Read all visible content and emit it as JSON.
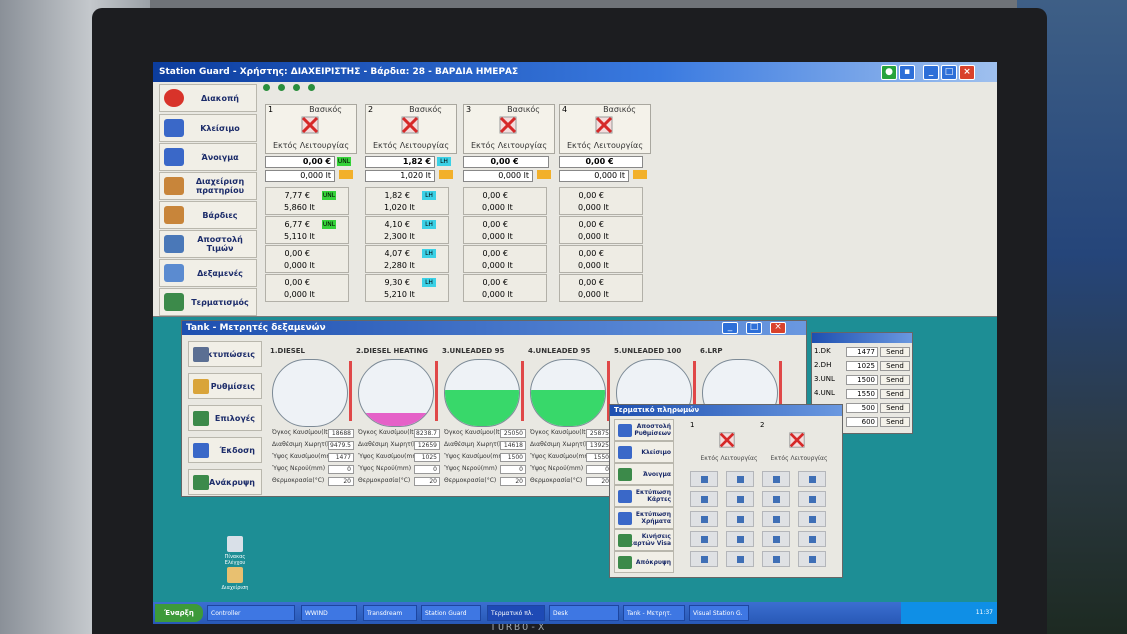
{
  "window": {
    "title": "Station Guard - Χρήστης: ΔΙΑΧΕΙΡΙΣΤΗΣ - Βάρδια: 28 - ΒΑΡΔΙΑ ΗΜΕΡΑΣ"
  },
  "sidebar": {
    "items": [
      {
        "label": "Διακοπή",
        "icon": "stop-icon"
      },
      {
        "label": "Κλείσιμο",
        "icon": "pump-close-icon"
      },
      {
        "label": "Άνοιγμα",
        "icon": "pump-open-icon"
      },
      {
        "label": "Διαχείριση πρατηρίου",
        "icon": "user-admin-icon"
      },
      {
        "label": "Βάρδιες",
        "icon": "users-icon"
      },
      {
        "label": "Αποστολή Τιμών",
        "icon": "price-send-icon"
      },
      {
        "label": "Δεξαμενές",
        "icon": "tank-icon"
      },
      {
        "label": "Τερματισμός",
        "icon": "exit-icon"
      }
    ]
  },
  "pumps": [
    {
      "num": "1",
      "mode": "Βασικός",
      "state": "Εκτός Λειτουργίας",
      "amount": "0,00 €",
      "fuel": "UNL",
      "volume": "0,000 lt",
      "rows": [
        {
          "n": "1",
          "a": "7,77 €",
          "f": "UNL",
          "b": "5,860 lt"
        },
        {
          "n": "2",
          "a": "6,77 €",
          "f": "UNL",
          "b": "5,110 lt"
        },
        {
          "n": "3",
          "a": "0,00 €",
          "f": "",
          "b": "0,000 lt"
        },
        {
          "n": "4",
          "a": "0,00 €",
          "f": "",
          "b": "0,000 lt"
        }
      ]
    },
    {
      "num": "2",
      "mode": "Βασικός",
      "state": "Εκτός Λειτουργίας",
      "amount": "1,82 €",
      "fuel": "LH",
      "volume": "1,020 lt",
      "rows": [
        {
          "n": "1",
          "a": "1,82 €",
          "f": "LH",
          "b": "1,020 lt"
        },
        {
          "n": "2",
          "a": "4,10 €",
          "f": "LH",
          "b": "2,300 lt"
        },
        {
          "n": "3",
          "a": "4,07 €",
          "f": "LH",
          "b": "2,280 lt"
        },
        {
          "n": "4",
          "a": "9,30 €",
          "f": "LH",
          "b": "5,210 lt"
        }
      ]
    },
    {
      "num": "3",
      "mode": "Βασικός",
      "state": "Εκτός Λειτουργίας",
      "amount": "0,00 €",
      "fuel": "",
      "volume": "0,000 lt",
      "rows": [
        {
          "n": "1",
          "a": "0,00 €",
          "f": "",
          "b": "0,000 lt"
        },
        {
          "n": "2",
          "a": "0,00 €",
          "f": "",
          "b": "0,000 lt"
        },
        {
          "n": "3",
          "a": "0,00 €",
          "f": "",
          "b": "0,000 lt"
        },
        {
          "n": "4",
          "a": "0,00 €",
          "f": "",
          "b": "0,000 lt"
        }
      ]
    },
    {
      "num": "4",
      "mode": "Βασικός",
      "state": "Εκτός Λειτουργίας",
      "amount": "0,00 €",
      "fuel": "",
      "volume": "0,000 lt",
      "rows": [
        {
          "n": "1",
          "a": "0,00 €",
          "f": "",
          "b": "0,000 lt"
        },
        {
          "n": "2",
          "a": "0,00 €",
          "f": "",
          "b": "0,000 lt"
        },
        {
          "n": "3",
          "a": "0,00 €",
          "f": "",
          "b": "0,000 lt"
        },
        {
          "n": "4",
          "a": "0,00 €",
          "f": "",
          "b": "0,000 lt"
        }
      ]
    }
  ],
  "tank_window": {
    "title": "Tank - Μετρητές δεξαμενών",
    "side": [
      "Εκτυπώσεις",
      "Ρυθμίσεις",
      "Επιλογές",
      "Έκδοση",
      "Ανάκρυψη"
    ],
    "tanks": [
      {
        "name": "1.DIESEL",
        "fill_pct": 0,
        "color": "#c9d4e0",
        "stats": [
          "18688",
          "9479.5",
          "1477",
          "0",
          "20"
        ]
      },
      {
        "name": "2.DIESEL HEATING",
        "fill_pct": 20,
        "color": "#e561c8",
        "stats": [
          "8238.7",
          "12659",
          "1025",
          "0",
          "20"
        ]
      },
      {
        "name": "3.UNLEADED 95",
        "fill_pct": 55,
        "color": "#38d86a",
        "stats": [
          "25050",
          "14618",
          "1500",
          "0",
          "20"
        ]
      },
      {
        "name": "4.UNLEADED 95",
        "fill_pct": 55,
        "color": "#38d86a",
        "stats": [
          "25875",
          "13925",
          "1550",
          "0",
          "20"
        ]
      },
      {
        "name": "5.UNLEADED 100",
        "fill_pct": 10,
        "color": "#52d8e8",
        "stats": []
      },
      {
        "name": "6.LRP",
        "fill_pct": 10,
        "color": "#e561c8",
        "stats": []
      }
    ],
    "stat_labels": [
      "Όγκος Καυσίμου(lt)",
      "Διαθέσιμη Χωρητ(lt)",
      "Ύψος Καυσίμου(mm)",
      "Ύψος Νερού(mm)",
      "Θερμοκρασία(°C)"
    ]
  },
  "price_window": {
    "rows": [
      {
        "name": "1.DK",
        "price": "1477",
        "send": "Send"
      },
      {
        "name": "2.DH",
        "price": "1025",
        "send": "Send"
      },
      {
        "name": "3.UNL",
        "price": "1500",
        "send": "Send"
      },
      {
        "name": "4.UNL",
        "price": "1550",
        "send": "Send"
      },
      {
        "name": "5.U",
        "price": "500",
        "send": "Send"
      },
      {
        "name": "6",
        "price": "600",
        "send": "Send"
      }
    ]
  },
  "terminal_window": {
    "title": "Τερματικό πληρωμών",
    "side": [
      "Αποστολή Ρυθμίσεων",
      "Κλείσιμο",
      "Άνοιγμα",
      "Εκτύπωση Κάρτες",
      "Εκτύπωση Χρήματα",
      "Κινήσεις καρτών Visa",
      "Απόκρυψη"
    ],
    "pumps": [
      {
        "num": "1",
        "state": "Εκτός Λειτουργίας"
      },
      {
        "num": "2",
        "state": "Εκτός Λειτουργίας"
      }
    ]
  },
  "desktop": {
    "icons": [
      "Πίνακας Ελέγχου",
      "Διαχείριση"
    ]
  },
  "taskbar": {
    "start": "Έναρξη",
    "tasks": [
      "Controller",
      "WWIND",
      "Transdream",
      "Station Guard",
      "Τερματικό πλ.",
      "Desk",
      "Tank - Μετρητ.",
      "Visual Station G."
    ],
    "clock": "11:37"
  },
  "brand": "TURBO-X"
}
